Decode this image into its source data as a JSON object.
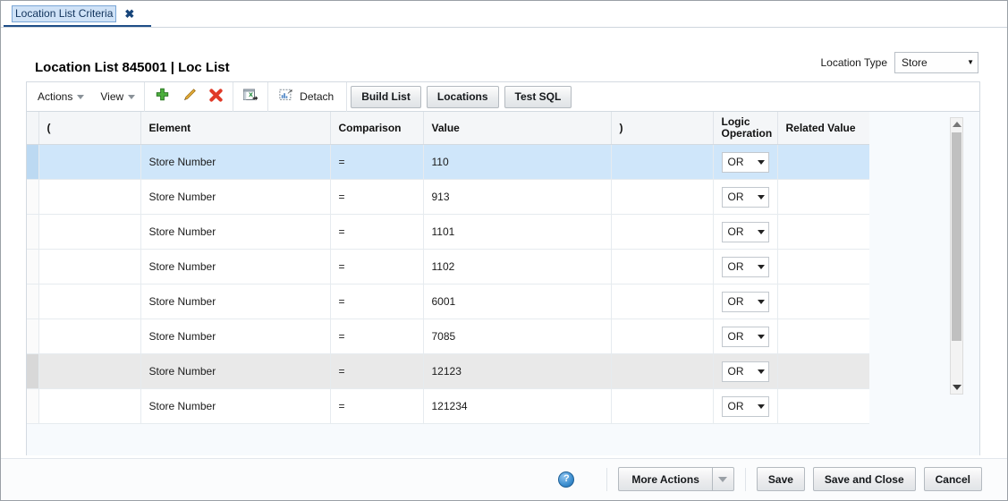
{
  "tab": {
    "label": "Location List Criteria",
    "close": "✖"
  },
  "header": {
    "title": "Location List 845001 | Loc List",
    "location_type_label": "Location Type",
    "location_type_value": "Store"
  },
  "toolbar": {
    "actions_label": "Actions",
    "view_label": "View",
    "add_icon": "add-icon",
    "edit_icon": "edit-icon",
    "delete_icon": "delete-icon",
    "export_icon": "export-to-excel-icon",
    "detach_label": "Detach",
    "detach_icon": "detach-icon",
    "build_list_label": "Build List",
    "locations_label": "Locations",
    "test_sql_label": "Test SQL"
  },
  "table": {
    "columns": [
      "(",
      "Element",
      "Comparison",
      "Value",
      ")",
      "Logic Operation",
      "Related Value"
    ],
    "logic_col_line1": "Logic",
    "logic_col_line2": "Operation",
    "rows": [
      {
        "paren_open": "",
        "element": "Store Number",
        "comparison": "=",
        "value": "110",
        "paren_close": "",
        "logic": "OR",
        "related_value": "",
        "state": "selected"
      },
      {
        "paren_open": "",
        "element": "Store Number",
        "comparison": "=",
        "value": "913",
        "paren_close": "",
        "logic": "OR",
        "related_value": "",
        "state": "normal"
      },
      {
        "paren_open": "",
        "element": "Store Number",
        "comparison": "=",
        "value": "1101",
        "paren_close": "",
        "logic": "OR",
        "related_value": "",
        "state": "normal"
      },
      {
        "paren_open": "",
        "element": "Store Number",
        "comparison": "=",
        "value": "1102",
        "paren_close": "",
        "logic": "OR",
        "related_value": "",
        "state": "normal"
      },
      {
        "paren_open": "",
        "element": "Store Number",
        "comparison": "=",
        "value": "6001",
        "paren_close": "",
        "logic": "OR",
        "related_value": "",
        "state": "normal"
      },
      {
        "paren_open": "",
        "element": "Store Number",
        "comparison": "=",
        "value": "7085",
        "paren_close": "",
        "logic": "OR",
        "related_value": "",
        "state": "normal"
      },
      {
        "paren_open": "",
        "element": "Store Number",
        "comparison": "=",
        "value": "12123",
        "paren_close": "",
        "logic": "OR",
        "related_value": "",
        "state": "hover"
      },
      {
        "paren_open": "",
        "element": "Store Number",
        "comparison": "=",
        "value": "121234",
        "paren_close": "",
        "logic": "OR",
        "related_value": "",
        "state": "normal"
      }
    ]
  },
  "footer": {
    "help_icon": "?",
    "more_actions_label": "More Actions",
    "save_label": "Save",
    "save_and_close_label": "Save and Close",
    "cancel_label": "Cancel"
  },
  "colors": {
    "tab_underline": "#1f4e87",
    "selected_row": "#cfe6fa",
    "hover_row": "#e9e9e9",
    "add_icon_green": "#3f9b35",
    "edit_icon_orange": "#e09a2b",
    "delete_icon_red": "#d62d20",
    "help_blue": "#3d8fd0"
  }
}
